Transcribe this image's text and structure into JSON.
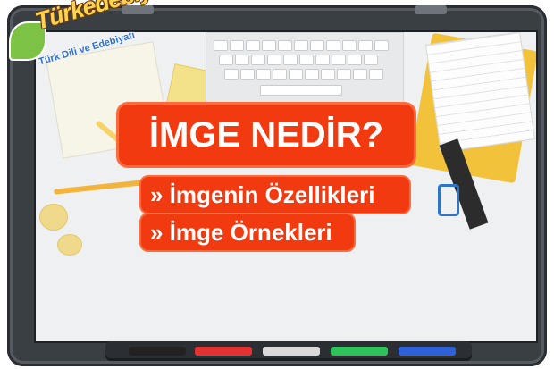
{
  "logo": {
    "name": "Türkedebiyatı.org",
    "tagline": "Türk Dili ve Edebiyatı"
  },
  "content": {
    "title": "İMGE NEDİR?",
    "links": [
      {
        "label": "» İmgenin Özellikleri"
      },
      {
        "label": "» İmge Örnekleri"
      }
    ]
  },
  "tray_markers": [
    {
      "color": "#222222",
      "name": "black"
    },
    {
      "color": "#e33232",
      "name": "red"
    },
    {
      "color": "#d9d9d9",
      "name": "white"
    },
    {
      "color": "#2ec25a",
      "name": "green"
    },
    {
      "color": "#2f62d8",
      "name": "blue"
    }
  ],
  "colors": {
    "badge": "#f23a11",
    "frame": "#3a3f44",
    "screen": "#eef0f1"
  }
}
